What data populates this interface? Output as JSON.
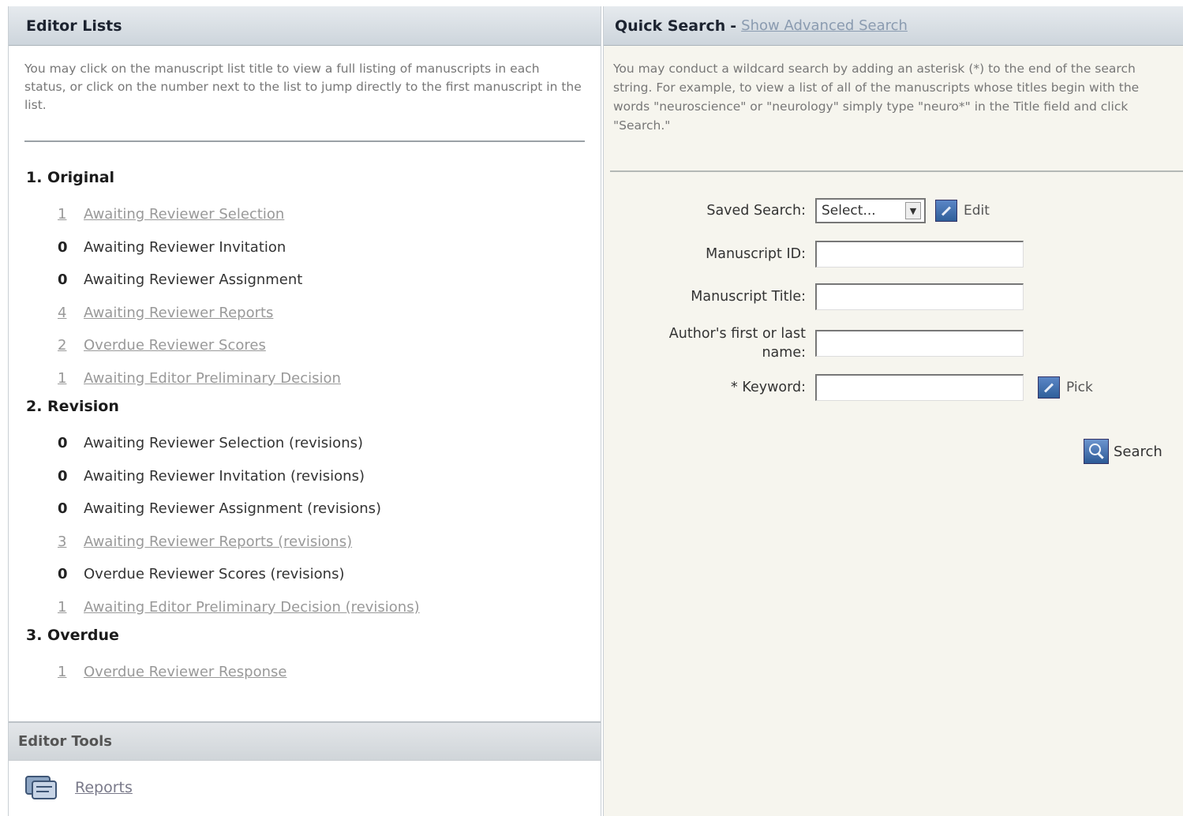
{
  "editor_lists": {
    "title": "Editor Lists",
    "intro": "You may click on the manuscript list title to view a full listing of manuscripts in each status, or click on the number next to the list to jump directly to the first manuscript in the list.",
    "groups": [
      {
        "title": "1. Original",
        "items": [
          {
            "count": "1",
            "label": "Awaiting Reviewer Selection",
            "link": true
          },
          {
            "count": "0",
            "label": "Awaiting Reviewer Invitation",
            "link": false
          },
          {
            "count": "0",
            "label": "Awaiting Reviewer Assignment",
            "link": false
          },
          {
            "count": "4",
            "label": "Awaiting Reviewer Reports",
            "link": true
          },
          {
            "count": "2",
            "label": "Overdue Reviewer Scores",
            "link": true
          },
          {
            "count": "1",
            "label": "Awaiting Editor Preliminary Decision",
            "link": true
          }
        ]
      },
      {
        "title": "2. Revision",
        "items": [
          {
            "count": "0",
            "label": "Awaiting Reviewer Selection (revisions)",
            "link": false
          },
          {
            "count": "0",
            "label": "Awaiting Reviewer Invitation (revisions)",
            "link": false
          },
          {
            "count": "0",
            "label": "Awaiting Reviewer Assignment (revisions)",
            "link": false
          },
          {
            "count": "3",
            "label": "Awaiting Reviewer Reports (revisions)",
            "link": true
          },
          {
            "count": "0",
            "label": "Overdue Reviewer Scores (revisions)",
            "link": false
          },
          {
            "count": "1",
            "label": "Awaiting Editor Preliminary Decision (revisions)",
            "link": true
          }
        ]
      },
      {
        "title": "3. Overdue",
        "items": [
          {
            "count": "1",
            "label": "Overdue Reviewer Response",
            "link": true
          }
        ]
      }
    ]
  },
  "editor_tools": {
    "title": "Editor Tools",
    "reports_label": "Reports",
    "reports_icon": "reports-icon"
  },
  "quick_search": {
    "title": "Quick Search",
    "separator": "-",
    "advanced_link": "Show Advanced Search",
    "intro": "You may conduct a wildcard search by adding an asterisk (*) to the end of the search string. For example, to view a list of all of the manuscripts whose titles begin with the words \"neuroscience\" or \"neurology\" simply type \"neuro*\" in the Title field and click \"Search.\"",
    "saved_search_label": "Saved Search:",
    "saved_search_value": "Select...",
    "edit_label": "Edit",
    "manuscript_id_label": "Manuscript ID:",
    "manuscript_id_value": "",
    "manuscript_title_label": "Manuscript Title:",
    "manuscript_title_value": "",
    "author_label": "Author's first or last name:",
    "author_value": "",
    "keyword_label": "* Keyword:",
    "keyword_value": "",
    "pick_label": "Pick",
    "search_label": "Search"
  },
  "colors": {
    "header_bg": "#d5dce2",
    "link": "#999999",
    "right_panel_bg": "#f6f5ee"
  }
}
